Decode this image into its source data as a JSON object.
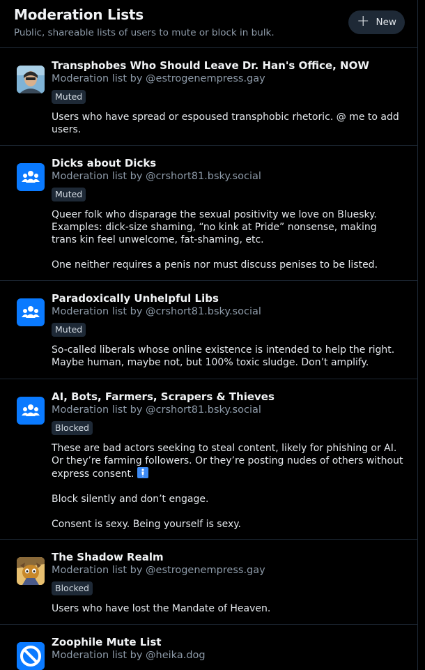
{
  "header": {
    "title": "Moderation Lists",
    "subtitle": "Public, shareable lists of users to mute or block in bulk.",
    "new_label": "New"
  },
  "lists": [
    {
      "title": "Transphobes Who Should Leave Dr. Han's Office, NOW",
      "byline": "Moderation list by @estrogenempress.gay",
      "status": "Muted",
      "desc": [
        "Users who have spread or espoused transphobic rhetoric. @ me to add users."
      ]
    },
    {
      "title": "Dicks about Dicks",
      "byline": "Moderation list by @crshort81.bsky.social",
      "status": "Muted",
      "desc": [
        "Queer folk who disparage the sexual positivity we love on Bluesky. Examples: dick-size shaming, “no kink at Pride” nonsense, making trans kin feel unwelcome, fat-shaming, etc.",
        "One neither requires a penis nor must discuss penises to be listed."
      ]
    },
    {
      "title": "Paradoxically Unhelpful Libs",
      "byline": "Moderation list by @crshort81.bsky.social",
      "status": "Muted",
      "desc": [
        "So-called liberals whose online existence is intended to help the right. Maybe human, maybe not, but 100% toxic sludge. Don’t amplify."
      ]
    },
    {
      "title": "AI, Bots, Farmers, Scrapers & Thieves",
      "byline": "Moderation list by @crshort81.bsky.social",
      "status": "Blocked",
      "desc": [
        "These are bad actors seeking to steal content, likely for phishing or AI. Or they’re farming followers. Or they’re posting nudes of others without express consent.",
        "Block silently and don’t engage.",
        "Consent is sexy. Being yourself is sexy."
      ]
    },
    {
      "title": "The Shadow Realm",
      "byline": "Moderation list by @estrogenempress.gay",
      "status": "Blocked",
      "desc": [
        "Users who have lost the Mandate of Heaven."
      ]
    },
    {
      "title": "Zoophile Mute List",
      "byline": "Moderation list by @heika.dog",
      "status": "",
      "desc": []
    }
  ],
  "colors": {
    "background": "#000000",
    "divider": "#1e2936",
    "accent": "#0a7aff",
    "muted_text": "#8d9aa8",
    "badge_bg": "#1e2936"
  },
  "icons": {
    "new": "plus-icon",
    "list_avatar": "people-group-icon",
    "mute_avatar": "prohibited-icon",
    "consent_emoji": "bathroom-person-emoji"
  }
}
